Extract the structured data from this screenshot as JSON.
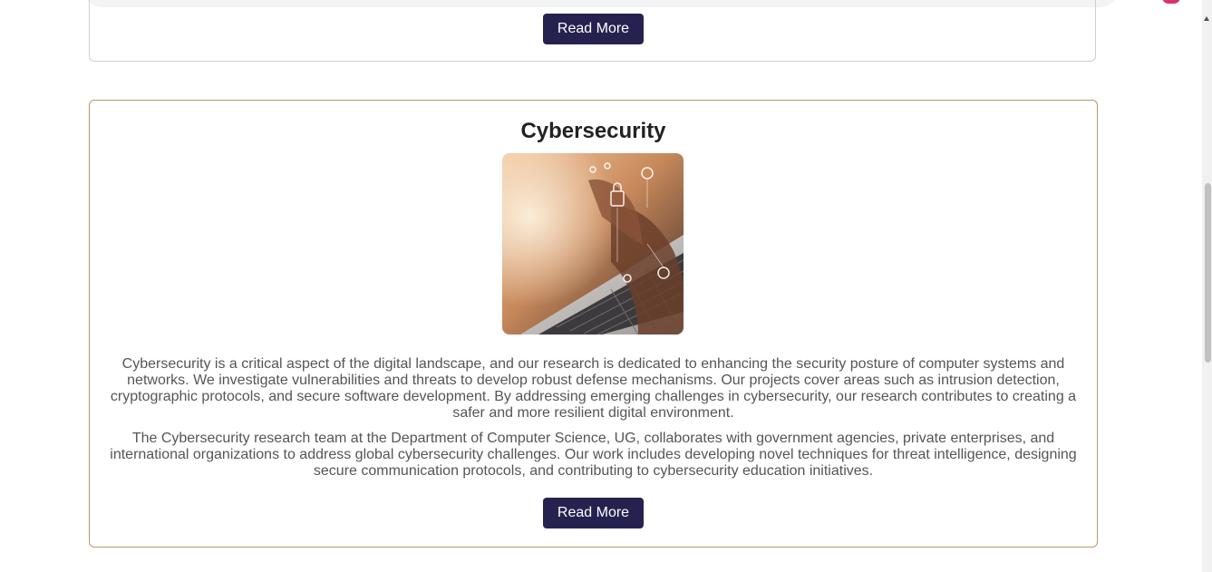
{
  "previous_card": {
    "button_label": "Read More"
  },
  "card": {
    "title": "Cybersecurity",
    "image_alt": "Hands typing on a laptop with security lock icons",
    "paragraph_1": "Cybersecurity is a critical aspect of the digital landscape, and our research is dedicated to enhancing the security posture of computer systems and networks. We investigate vulnerabilities and threats to develop robust defense mechanisms. Our projects cover areas such as intrusion detection, cryptographic protocols, and secure software development. By addressing emerging challenges in cybersecurity, our research contributes to creating a safer and more resilient digital environment.",
    "paragraph_2": "The Cybersecurity research team at the Department of Computer Science, UG, collaborates with government agencies, private enterprises, and international organizations to address global cybersecurity challenges. Our work includes developing novel techniques for threat intelligence, designing secure communication protocols, and contributing to cybersecurity education initiatives.",
    "button_label": "Read More"
  },
  "colors": {
    "button_bg": "#26224f",
    "card_border": "#b8986a",
    "text": "#555555",
    "title": "#222222"
  }
}
